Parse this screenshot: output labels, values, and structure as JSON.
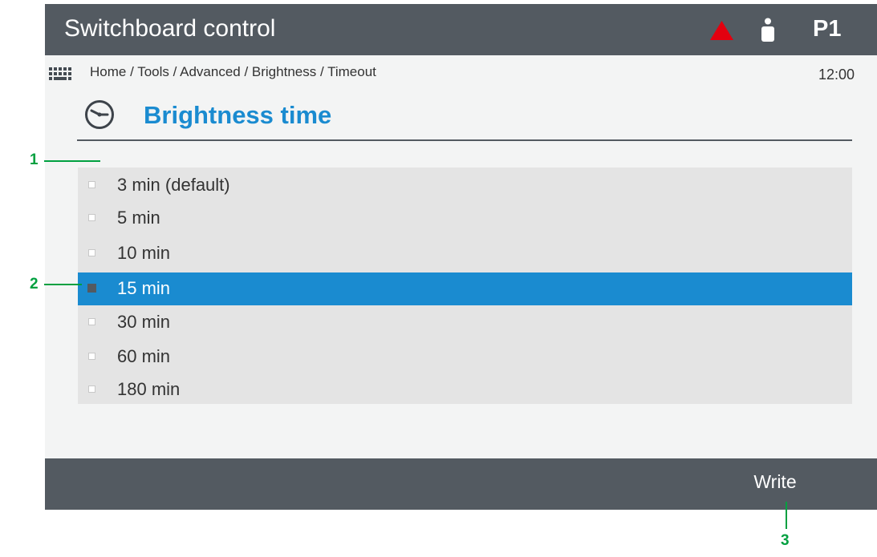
{
  "header": {
    "title": "Switchboard control",
    "alarm_icon": "alarm-triangle-icon",
    "user_icon": "user-icon",
    "profile": "P1"
  },
  "subheader": {
    "keypad_icon": "keypad-icon",
    "breadcrumb": "Home / Tools / Advanced / Brightness / Timeout",
    "time": "12:00"
  },
  "page": {
    "icon": "clock-icon",
    "title": "Brightness time"
  },
  "options": [
    {
      "label": "3 min (default)",
      "selected": false
    },
    {
      "label": "5 min",
      "selected": false
    },
    {
      "label": "10 min",
      "selected": false
    },
    {
      "label": "15 min",
      "selected": true
    },
    {
      "label": "30 min",
      "selected": false
    },
    {
      "label": "60 min",
      "selected": false
    },
    {
      "label": "180 min",
      "selected": false
    }
  ],
  "footer": {
    "write_label": "Write"
  },
  "callouts": [
    "1",
    "2",
    "3"
  ],
  "colors": {
    "bar": "#535a61",
    "accent": "#1a8bd0",
    "alarm": "#e3000f",
    "callout": "#00a040",
    "list_bg": "#e4e4e4",
    "screen_bg": "#f3f4f4"
  }
}
